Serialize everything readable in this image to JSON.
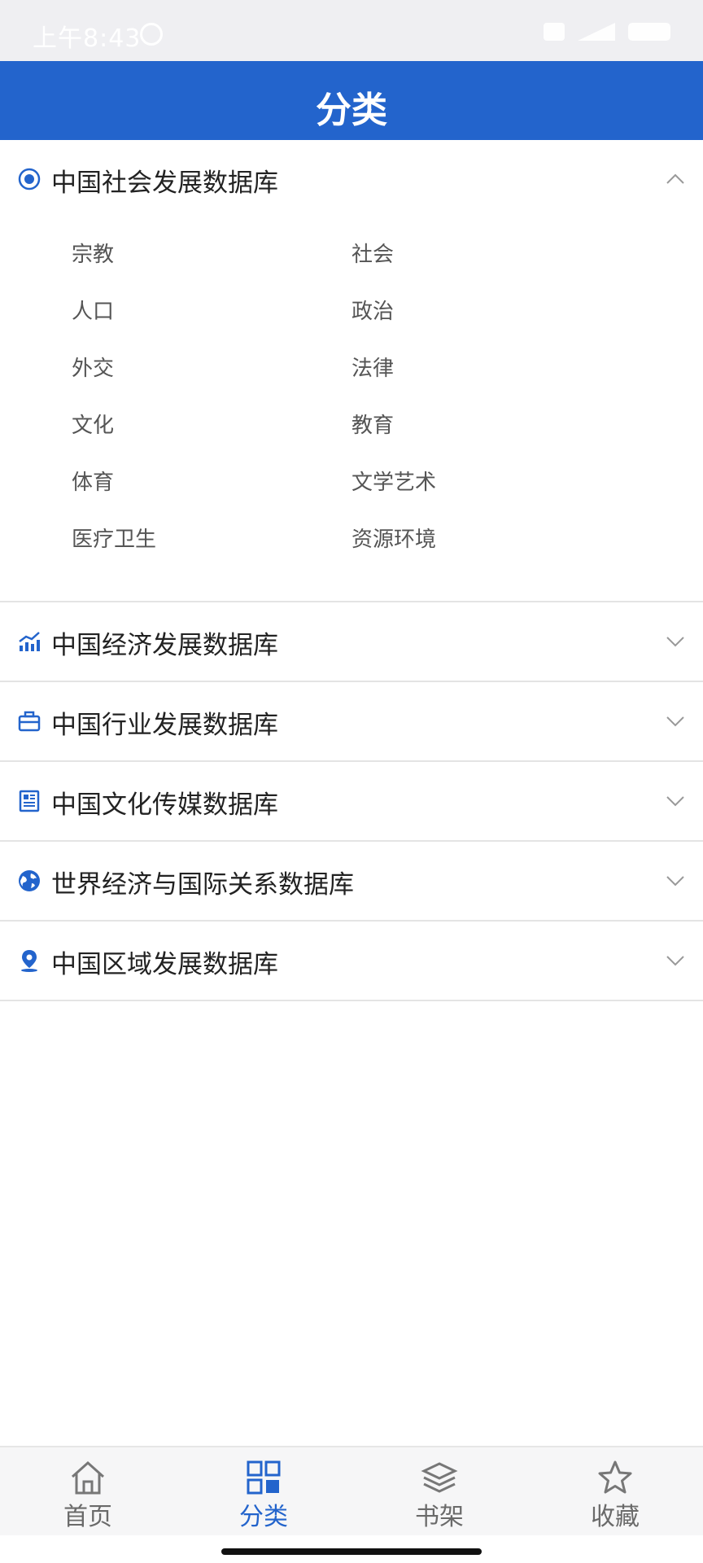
{
  "status_bar": {
    "time": "上午8:43"
  },
  "header": {
    "title": "分类"
  },
  "colors": {
    "accent": "#2364cc",
    "text": "#222222",
    "sub_text": "#555555"
  },
  "sections": [
    {
      "title": "中国社会发展数据库",
      "icon": "society-globe-icon",
      "expanded": true,
      "items": [
        "宗教",
        "社会",
        "人口",
        "政治",
        "外交",
        "法律",
        "文化",
        "教育",
        "体育",
        "文学艺术",
        "医疗卫生",
        "资源环境"
      ]
    },
    {
      "title": "中国经济发展数据库",
      "icon": "trend-chart-icon",
      "expanded": false
    },
    {
      "title": "中国行业发展数据库",
      "icon": "briefcase-icon",
      "expanded": false
    },
    {
      "title": "中国文化传媒数据库",
      "icon": "newspaper-icon",
      "expanded": false
    },
    {
      "title": "世界经济与国际关系数据库",
      "icon": "world-globe-icon",
      "expanded": false
    },
    {
      "title": "中国区域发展数据库",
      "icon": "location-pin-icon",
      "expanded": false
    }
  ],
  "tabbar": [
    {
      "label": "首页",
      "icon": "home-icon",
      "active": false
    },
    {
      "label": "分类",
      "icon": "category-grid-icon",
      "active": true
    },
    {
      "label": "书架",
      "icon": "layers-icon",
      "active": false
    },
    {
      "label": "收藏",
      "icon": "star-icon",
      "active": false
    }
  ]
}
